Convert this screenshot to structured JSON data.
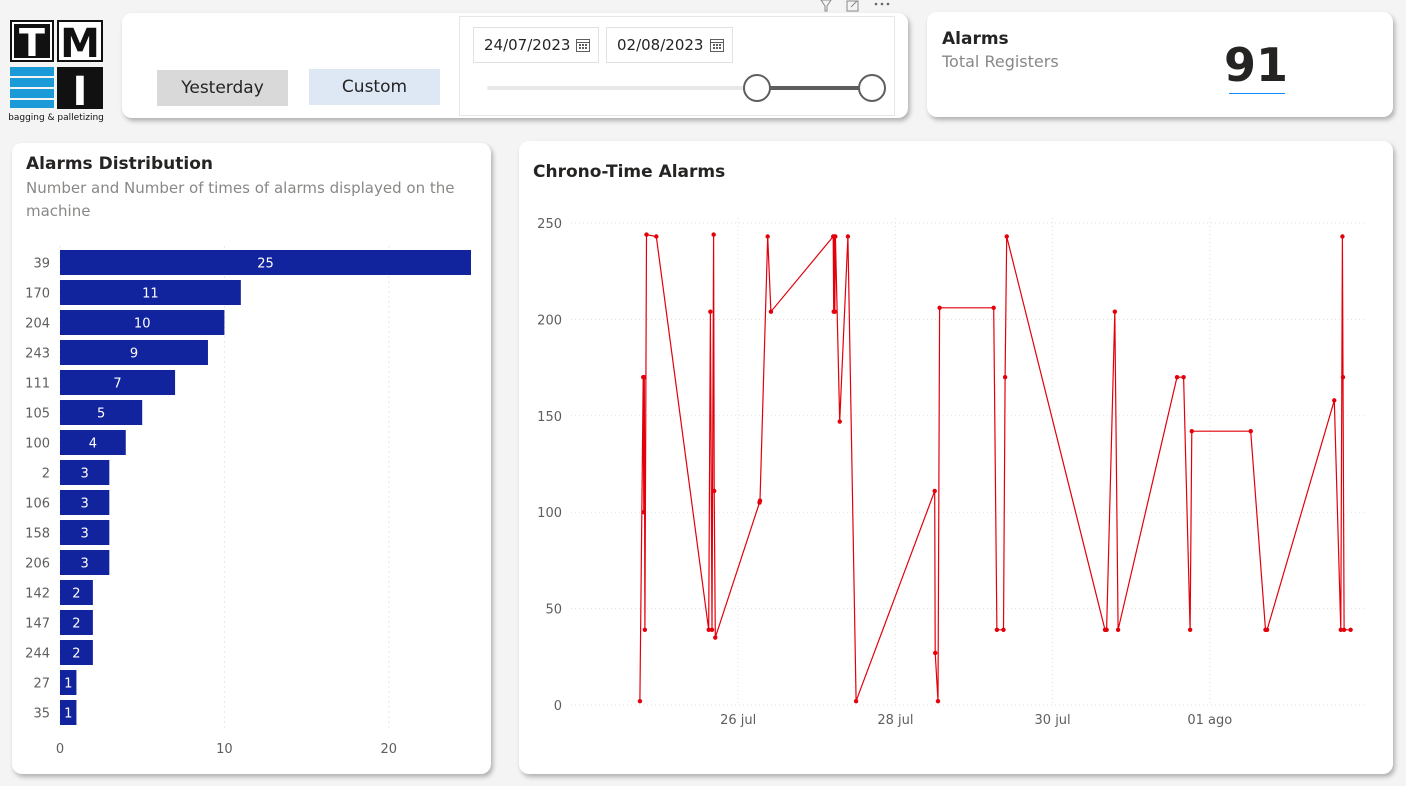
{
  "logo": {
    "letters": [
      "T",
      "M",
      "I"
    ],
    "tagline": "bagging & palletizing"
  },
  "filter": {
    "yesterday_label": "Yesterday",
    "custom_label": "Custom",
    "start_date": "24/07/2023",
    "end_date": "02/08/2023",
    "header_icons": [
      "filter-icon",
      "focus-mode-icon",
      "more-options-icon"
    ],
    "slider_value": [
      0.7,
      1.0
    ]
  },
  "kpi": {
    "title": "Alarms",
    "subtitle": "Total Registers",
    "value": "91",
    "accent": "#118dff"
  },
  "distribution": {
    "title": "Alarms Distribution",
    "subtitle": "Number and Number of times of alarms displayed on the machine"
  },
  "chrono": {
    "title": "Chrono-Time Alarms"
  },
  "chart_data": [
    {
      "type": "bar",
      "orientation": "horizontal",
      "color": "#12239e",
      "categories": [
        "39",
        "170",
        "204",
        "243",
        "111",
        "105",
        "100",
        "2",
        "106",
        "158",
        "206",
        "142",
        "147",
        "244",
        "27",
        "35"
      ],
      "values": [
        25,
        11,
        10,
        9,
        7,
        5,
        4,
        3,
        3,
        3,
        3,
        2,
        2,
        2,
        1,
        1
      ],
      "xlim": [
        0,
        25
      ],
      "xticks": [
        0,
        10,
        20
      ],
      "grid": true
    },
    {
      "type": "line",
      "color": "#e3000b",
      "xlim": [
        "24/07/2023",
        "03/08/2023"
      ],
      "ylim": [
        0,
        250
      ],
      "yticks": [
        0,
        50,
        100,
        150,
        200,
        250
      ],
      "xticks": [
        {
          "x": "26/07/2023",
          "label": "26 jul"
        },
        {
          "x": "28/07/2023",
          "label": "28 jul"
        },
        {
          "x": "30/07/2023",
          "label": "30 jul"
        },
        {
          "x": "01/08/2023",
          "label": "01 ago"
        }
      ],
      "grid": true,
      "series": [
        {
          "points": [
            {
              "x": "24/07/2023 18:00",
              "y": 2
            },
            {
              "x": "24/07/2023 19:00",
              "y": 170
            },
            {
              "x": "24/07/2023 19:10",
              "y": 100
            },
            {
              "x": "24/07/2023 19:20",
              "y": 170
            },
            {
              "x": "24/07/2023 19:30",
              "y": 39
            },
            {
              "x": "24/07/2023 20:00",
              "y": 244
            },
            {
              "x": "24/07/2023 23:00",
              "y": 243
            },
            {
              "x": "25/07/2023 15:00",
              "y": 39
            },
            {
              "x": "25/07/2023 15:30",
              "y": 204
            },
            {
              "x": "25/07/2023 16:00",
              "y": 39
            },
            {
              "x": "25/07/2023 16:30",
              "y": 244
            },
            {
              "x": "25/07/2023 16:40",
              "y": 111
            },
            {
              "x": "25/07/2023 17:00",
              "y": 35
            },
            {
              "x": "26/07/2023 06:30",
              "y": 105
            },
            {
              "x": "26/07/2023 06:40",
              "y": 106
            },
            {
              "x": "26/07/2023 09:00",
              "y": 243
            },
            {
              "x": "26/07/2023 10:00",
              "y": 204
            },
            {
              "x": "27/07/2023 05:00",
              "y": 243
            },
            {
              "x": "27/07/2023 05:10",
              "y": 204
            },
            {
              "x": "27/07/2023 05:20",
              "y": 243
            },
            {
              "x": "27/07/2023 05:30",
              "y": 204
            },
            {
              "x": "27/07/2023 05:40",
              "y": 243
            },
            {
              "x": "27/07/2023 07:00",
              "y": 147
            },
            {
              "x": "27/07/2023 09:30",
              "y": 243
            },
            {
              "x": "27/07/2023 12:00",
              "y": 2
            },
            {
              "x": "28/07/2023 12:00",
              "y": 111
            },
            {
              "x": "28/07/2023 12:10",
              "y": 27
            },
            {
              "x": "28/07/2023 13:00",
              "y": 2
            },
            {
              "x": "28/07/2023 13:30",
              "y": 206
            },
            {
              "x": "29/07/2023 06:00",
              "y": 206
            },
            {
              "x": "29/07/2023 07:00",
              "y": 39
            },
            {
              "x": "29/07/2023 09:00",
              "y": 39
            },
            {
              "x": "29/07/2023 09:30",
              "y": 170
            },
            {
              "x": "29/07/2023 10:00",
              "y": 243
            },
            {
              "x": "30/07/2023 16:00",
              "y": 39
            },
            {
              "x": "30/07/2023 16:30",
              "y": 39
            },
            {
              "x": "30/07/2023 19:00",
              "y": 204
            },
            {
              "x": "30/07/2023 20:00",
              "y": 39
            },
            {
              "x": "31/07/2023 14:00",
              "y": 170
            },
            {
              "x": "31/07/2023 16:00",
              "y": 170
            },
            {
              "x": "31/07/2023 18:00",
              "y": 39
            },
            {
              "x": "31/07/2023 18:30",
              "y": 142
            },
            {
              "x": "01/08/2023 12:30",
              "y": 142
            },
            {
              "x": "01/08/2023 17:00",
              "y": 39
            },
            {
              "x": "01/08/2023 17:30",
              "y": 39
            },
            {
              "x": "02/08/2023 14:00",
              "y": 158
            },
            {
              "x": "02/08/2023 16:00",
              "y": 39
            },
            {
              "x": "02/08/2023 16:30",
              "y": 243
            },
            {
              "x": "02/08/2023 16:40",
              "y": 170
            },
            {
              "x": "02/08/2023 17:00",
              "y": 39
            },
            {
              "x": "02/08/2023 19:00",
              "y": 39
            }
          ]
        }
      ]
    }
  ]
}
